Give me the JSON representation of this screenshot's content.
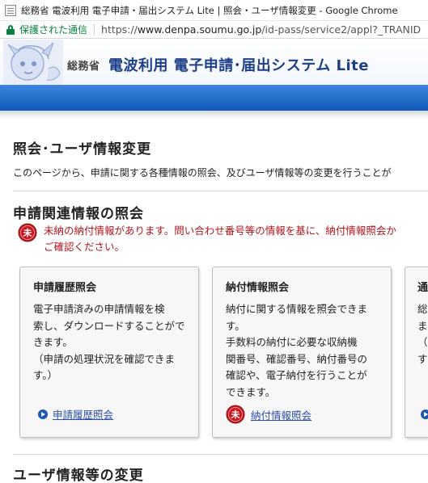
{
  "browser": {
    "window_title": "総務省 電波利用 電子申請・届出システム Lite | 照会・ユーザ情報変更 - Google Chrome",
    "secure_label": "保護された通信",
    "url_scheme": "https://",
    "url_host": "www.denpa.soumu.go.jp",
    "url_path": "/id-pass/service2/appl?_TRANID"
  },
  "site": {
    "ministry": "総務省",
    "system_name": "電波利用 電子申請･届出システム Lite"
  },
  "page": {
    "title": "照会･ユーザ情報変更",
    "description": "このページから、申請に関する各種情報の照会、及びユーザ情報等の変更を行うことが"
  },
  "section_inquiry": {
    "title": "申請関連情報の照会",
    "alert_line1": "未納の納付情報があります。問い合わせ番号等の情報を基に、納付情報照会か",
    "alert_line2": "ご確認ください。",
    "alert_icon_glyph": "未"
  },
  "cards": [
    {
      "title": "申請履歴照会",
      "lines": [
        "電子申請済みの申請情報を検",
        "索し、ダウンロードすることがで",
        "きます。",
        "（申請の処理状況を確認できま",
        "す。）"
      ],
      "link": "申請履歴照会"
    },
    {
      "title": "納付情報照会",
      "lines": [
        "納付に関する情報を照会できま",
        "す。",
        "手数料の納付に必要な収納機",
        "関番号、確認番号、納付番号の",
        "確認や、電子納付を行うことが",
        "できます。"
      ],
      "link": "納付情報照会",
      "link_icon_glyph": "未"
    },
    {
      "title": "通",
      "lines": [
        "総",
        "ま",
        "（衫",
        "す"
      ]
    }
  ],
  "section_user": {
    "title": "ユーザ情報等の変更"
  },
  "colors": {
    "brand_blue": "#1259b8",
    "alert_red": "#b3121a",
    "link_blue": "#2c4fa6",
    "secure_green": "#0b8043"
  }
}
